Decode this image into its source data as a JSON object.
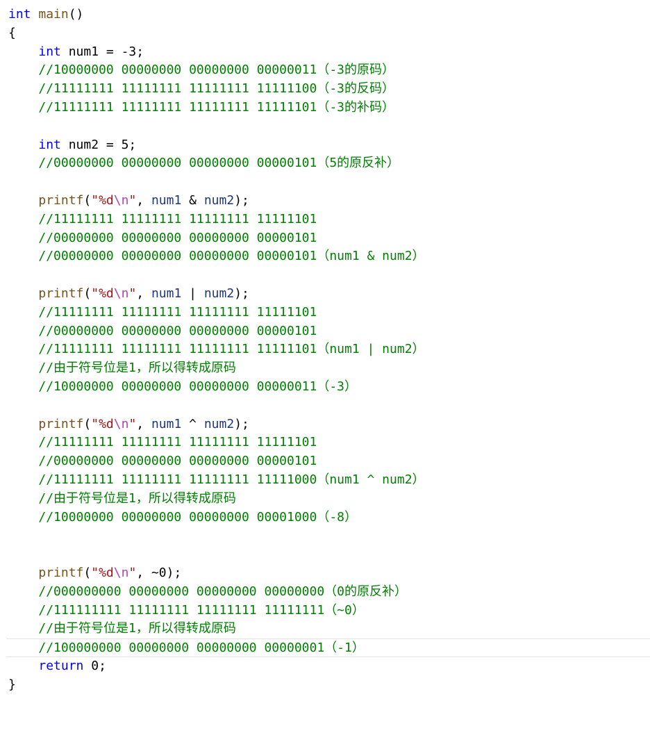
{
  "editor": {
    "lines": [
      [
        {
          "t": "kw",
          "v": "int"
        },
        {
          "t": "pl",
          "v": " "
        },
        {
          "t": "fn",
          "v": "main"
        },
        {
          "t": "pl",
          "v": "()"
        }
      ],
      [
        {
          "t": "pl",
          "v": "{"
        }
      ],
      [
        {
          "t": "pl",
          "v": "    "
        },
        {
          "t": "kw",
          "v": "int"
        },
        {
          "t": "pl",
          "v": " num1 = -3;"
        }
      ],
      [
        {
          "t": "pl",
          "v": "    "
        },
        {
          "t": "cmt",
          "v": "//10000000 00000000 00000000 00000011（-3的原码）"
        }
      ],
      [
        {
          "t": "pl",
          "v": "    "
        },
        {
          "t": "cmt",
          "v": "//11111111 11111111 11111111 11111100（-3的反码）"
        }
      ],
      [
        {
          "t": "pl",
          "v": "    "
        },
        {
          "t": "cmt",
          "v": "//11111111 11111111 11111111 11111101（-3的补码）"
        }
      ],
      [],
      [
        {
          "t": "pl",
          "v": "    "
        },
        {
          "t": "kw",
          "v": "int"
        },
        {
          "t": "pl",
          "v": " num2 = 5;"
        }
      ],
      [
        {
          "t": "pl",
          "v": "    "
        },
        {
          "t": "cmt",
          "v": "//00000000 00000000 00000000 00000101（5的原反补）"
        }
      ],
      [],
      [
        {
          "t": "pl",
          "v": "    "
        },
        {
          "t": "fn",
          "v": "printf"
        },
        {
          "t": "pl",
          "v": "("
        },
        {
          "t": "str",
          "v": "\"%d"
        },
        {
          "t": "esc",
          "v": "\\n"
        },
        {
          "t": "str",
          "v": "\""
        },
        {
          "t": "pl",
          "v": ", "
        },
        {
          "t": "var",
          "v": "num1"
        },
        {
          "t": "pl",
          "v": " & "
        },
        {
          "t": "var",
          "v": "num2"
        },
        {
          "t": "pl",
          "v": ");"
        }
      ],
      [
        {
          "t": "pl",
          "v": "    "
        },
        {
          "t": "cmt",
          "v": "//11111111 11111111 11111111 11111101"
        }
      ],
      [
        {
          "t": "pl",
          "v": "    "
        },
        {
          "t": "cmt",
          "v": "//00000000 00000000 00000000 00000101"
        }
      ],
      [
        {
          "t": "pl",
          "v": "    "
        },
        {
          "t": "cmt",
          "v": "//00000000 00000000 00000000 00000101（num1 & num2）"
        }
      ],
      [],
      [
        {
          "t": "pl",
          "v": "    "
        },
        {
          "t": "fn",
          "v": "printf"
        },
        {
          "t": "pl",
          "v": "("
        },
        {
          "t": "str",
          "v": "\"%d"
        },
        {
          "t": "esc",
          "v": "\\n"
        },
        {
          "t": "str",
          "v": "\""
        },
        {
          "t": "pl",
          "v": ", "
        },
        {
          "t": "var",
          "v": "num1"
        },
        {
          "t": "pl",
          "v": " | "
        },
        {
          "t": "var",
          "v": "num2"
        },
        {
          "t": "pl",
          "v": ");"
        }
      ],
      [
        {
          "t": "pl",
          "v": "    "
        },
        {
          "t": "cmt",
          "v": "//11111111 11111111 11111111 11111101"
        }
      ],
      [
        {
          "t": "pl",
          "v": "    "
        },
        {
          "t": "cmt",
          "v": "//00000000 00000000 00000000 00000101"
        }
      ],
      [
        {
          "t": "pl",
          "v": "    "
        },
        {
          "t": "cmt",
          "v": "//11111111 11111111 11111111 11111101（num1 | num2）"
        }
      ],
      [
        {
          "t": "pl",
          "v": "    "
        },
        {
          "t": "cmt",
          "v": "//由于符号位是1，所以得转成原码"
        }
      ],
      [
        {
          "t": "pl",
          "v": "    "
        },
        {
          "t": "cmt",
          "v": "//10000000 00000000 00000000 00000011（-3）"
        }
      ],
      [],
      [
        {
          "t": "pl",
          "v": "    "
        },
        {
          "t": "fn",
          "v": "printf"
        },
        {
          "t": "pl",
          "v": "("
        },
        {
          "t": "str",
          "v": "\"%d"
        },
        {
          "t": "esc",
          "v": "\\n"
        },
        {
          "t": "str",
          "v": "\""
        },
        {
          "t": "pl",
          "v": ", "
        },
        {
          "t": "var",
          "v": "num1"
        },
        {
          "t": "pl",
          "v": " ^ "
        },
        {
          "t": "var",
          "v": "num2"
        },
        {
          "t": "pl",
          "v": ");"
        }
      ],
      [
        {
          "t": "pl",
          "v": "    "
        },
        {
          "t": "cmt",
          "v": "//11111111 11111111 11111111 11111101"
        }
      ],
      [
        {
          "t": "pl",
          "v": "    "
        },
        {
          "t": "cmt",
          "v": "//00000000 00000000 00000000 00000101"
        }
      ],
      [
        {
          "t": "pl",
          "v": "    "
        },
        {
          "t": "cmt",
          "v": "//11111111 11111111 11111111 11111000（num1 ^ num2）"
        }
      ],
      [
        {
          "t": "pl",
          "v": "    "
        },
        {
          "t": "cmt",
          "v": "//由于符号位是1，所以得转成原码"
        }
      ],
      [
        {
          "t": "pl",
          "v": "    "
        },
        {
          "t": "cmt",
          "v": "//10000000 00000000 00000000 00001000（-8）"
        }
      ],
      [],
      [],
      [
        {
          "t": "pl",
          "v": "    "
        },
        {
          "t": "fn",
          "v": "printf"
        },
        {
          "t": "pl",
          "v": "("
        },
        {
          "t": "str",
          "v": "\"%d"
        },
        {
          "t": "esc",
          "v": "\\n"
        },
        {
          "t": "str",
          "v": "\""
        },
        {
          "t": "pl",
          "v": ", ~0);"
        }
      ],
      [
        {
          "t": "pl",
          "v": "    "
        },
        {
          "t": "cmt",
          "v": "//000000000 00000000 00000000 00000000（0的原反补）"
        }
      ],
      [
        {
          "t": "pl",
          "v": "    "
        },
        {
          "t": "cmt",
          "v": "//111111111 11111111 11111111 11111111（~0）"
        }
      ],
      [
        {
          "t": "pl",
          "v": "    "
        },
        {
          "t": "cmt",
          "v": "//由于符号位是1，所以得转成原码"
        }
      ],
      [
        {
          "t": "pl",
          "v": "    "
        },
        {
          "t": "cmt",
          "v": "//100000000 00000000 00000000 00000001（-1）"
        }
      ],
      [
        {
          "t": "pl",
          "v": "    "
        },
        {
          "t": "kw",
          "v": "return"
        },
        {
          "t": "pl",
          "v": " 0;"
        }
      ],
      [
        {
          "t": "pl",
          "v": "}"
        }
      ]
    ],
    "current_line": 34,
    "colors": {
      "keyword": "#0000ff",
      "function": "#74531f",
      "string": "#a31515",
      "escape": "#b342b4",
      "variable": "#1f377f",
      "comment": "#008000",
      "plain": "#000000",
      "current_line_border": "#e4e4e4"
    }
  }
}
